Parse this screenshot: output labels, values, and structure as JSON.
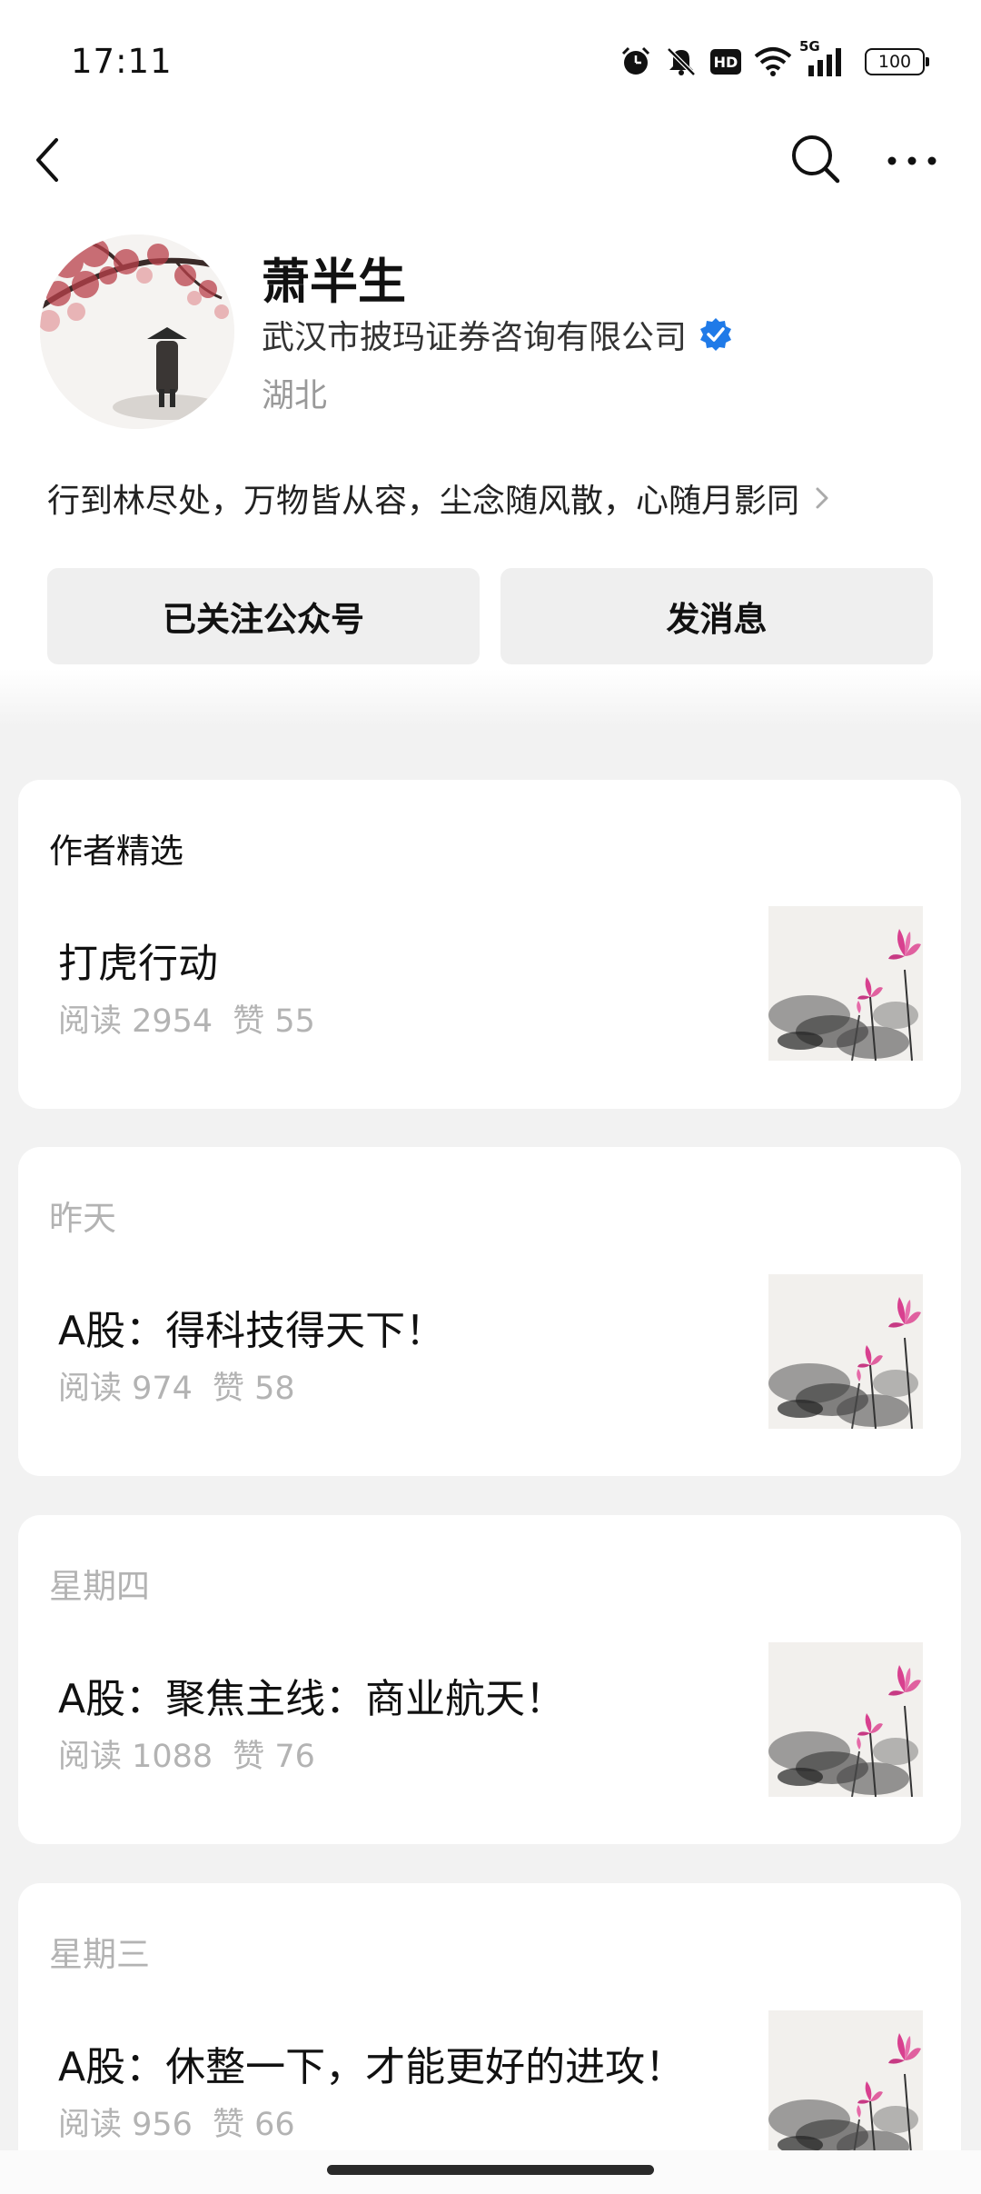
{
  "status_bar": {
    "time": "17:11",
    "network": "5G",
    "hd": "HD",
    "battery": "100"
  },
  "profile": {
    "name": "萧半生",
    "company": "武汉市披玛证券咨询有限公司",
    "region": "湖北",
    "signature": "行到林尽处，万物皆从容，尘念随风散，心随月影同"
  },
  "actions": {
    "follow_label": "已关注公众号",
    "message_label": "发消息"
  },
  "featured": {
    "header": "作者精选",
    "title": "打虎行动",
    "reads": "阅读 2954",
    "likes": "赞 55"
  },
  "articles": [
    {
      "date": "昨天",
      "title": "A股：得科技得天下！",
      "reads": "阅读 974",
      "likes": "赞 58"
    },
    {
      "date": "星期四",
      "title": "A股：聚焦主线：商业航天！",
      "reads": "阅读 1088",
      "likes": "赞 76"
    },
    {
      "date": "星期三",
      "title": "A股：休整一下，才能更好的进攻！",
      "reads": "阅读 956",
      "likes": "赞 66"
    }
  ],
  "colors": {
    "verified": "#1f7ae8",
    "muted_text": "#b3b3b3",
    "lotus_pink": "#d8408f"
  },
  "icons": [
    "back-icon",
    "search-icon",
    "more-icon",
    "verified-icon",
    "chevron-right-icon",
    "alarm-icon",
    "mute-icon",
    "wifi-icon",
    "signal-icon"
  ]
}
